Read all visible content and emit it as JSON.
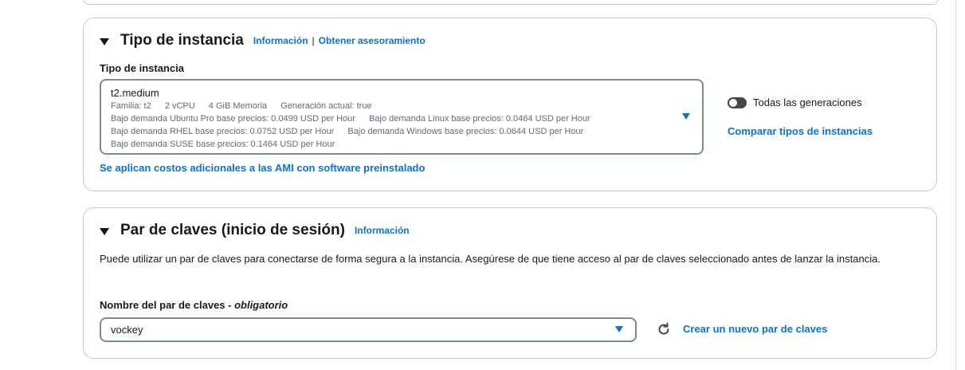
{
  "instance_section": {
    "title": "Tipo de instancia",
    "info_link": "Información",
    "separator": "|",
    "advice_link": "Obtener asesoramiento",
    "field_label": "Tipo de instancia",
    "selected": {
      "name": "t2.medium",
      "family": "Familia: t2",
      "vcpu": "2 vCPU",
      "memory": "4 GiB Memoria",
      "generation": "Generación actual: true",
      "ubuntu_price": "Bajo demanda Ubuntu Pro base precios: 0.0499 USD per Hour",
      "linux_price": "Bajo demanda Linux base precios: 0.0464 USD per Hour",
      "rhel_price": "Bajo demanda RHEL base precios: 0.0752 USD per Hour",
      "windows_price": "Bajo demanda Windows base precios: 0.0644 USD per Hour",
      "suse_price": "Bajo demanda SUSE base precios: 0.1464 USD per Hour"
    },
    "all_generations_label": "Todas las generaciones",
    "all_generations_on": false,
    "compare_link": "Comparar tipos de instancias",
    "ami_costs_link": "Se aplican costos adicionales a las AMI con software preinstalado"
  },
  "keypair_section": {
    "title": "Par de claves (inicio de sesión)",
    "info_link": "Información",
    "description": "Puede utilizar un par de claves para conectarse de forma segura a la instancia. Asegúrese de que tiene acceso al par de claves seleccionado antes de lanzar la instancia.",
    "field_label": "Nombre del par de claves - ",
    "field_required": "obligatorio",
    "selected_value": "vockey",
    "create_link": "Crear un nuevo par de claves"
  },
  "icons": {
    "collapse": "caret-down-icon",
    "dropdown": "dropdown-caret-icon",
    "refresh": "refresh-icon"
  },
  "colors": {
    "link": "#0972d3",
    "text": "#16191f",
    "border": "#7d8998",
    "card_border": "#c6c6cd"
  }
}
